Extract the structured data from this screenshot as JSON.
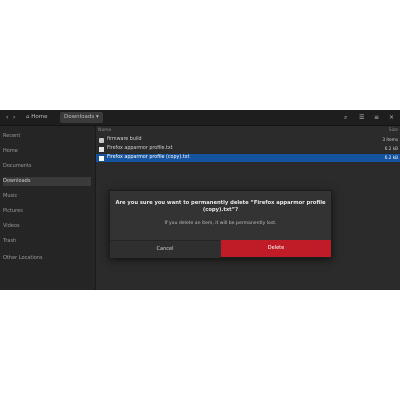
{
  "header": {
    "home_crumb": "Home",
    "current_crumb": "Downloads"
  },
  "sidebar": {
    "items": [
      {
        "label": "Recent"
      },
      {
        "label": "Home"
      },
      {
        "label": "Documents"
      },
      {
        "label": "Downloads"
      },
      {
        "label": "Music"
      },
      {
        "label": "Pictures"
      },
      {
        "label": "Videos"
      },
      {
        "label": "Trash"
      },
      {
        "label": "Other Locations"
      }
    ]
  },
  "main": {
    "column_name": "Name",
    "column_size": "Size",
    "rows": [
      {
        "name": "firmware build",
        "size": "3 items",
        "type": "folder"
      },
      {
        "name": "Firefox apparmor profile.txt",
        "size": "6.2 kB",
        "type": "file"
      },
      {
        "name": "Firefox apparmor profile (copy).txt",
        "size": "6.2 kB",
        "type": "file"
      }
    ]
  },
  "dialog": {
    "title": "Are you sure you want to permanently delete “Firefox apparmor profile (copy).txt”?",
    "subtitle": "If you delete an item, it will be permanently lost.",
    "cancel_label": "Cancel",
    "delete_label": "Delete"
  },
  "colors": {
    "selection": "#15539e",
    "destructive": "#c01c28"
  }
}
